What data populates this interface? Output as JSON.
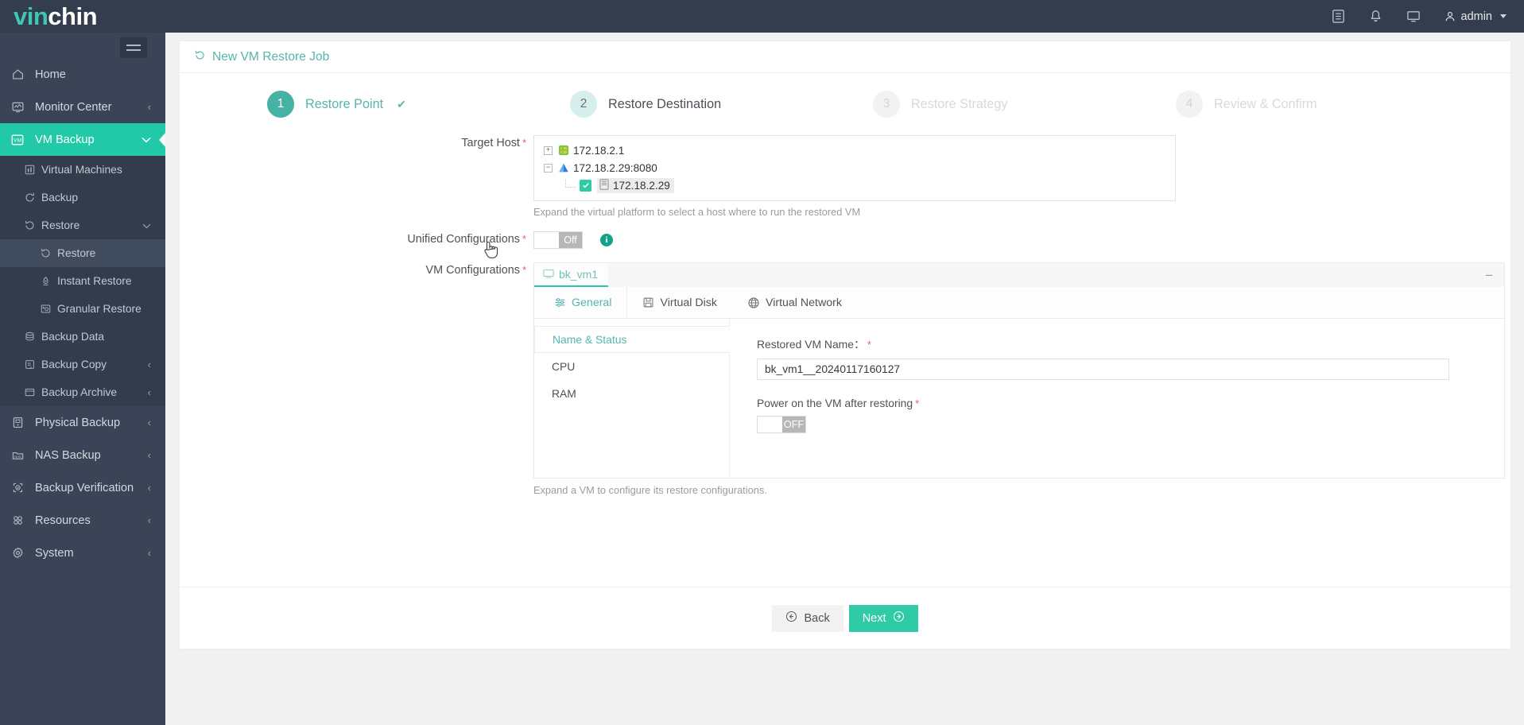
{
  "topbar": {
    "logo_part1": "vin",
    "logo_part2": "chin",
    "icons": [
      "list-icon",
      "bell-icon",
      "monitor-icon"
    ],
    "user": "admin"
  },
  "sidebar": {
    "hamburger": "hamburger-icon",
    "items": [
      {
        "label": "Home",
        "icon": "home-icon",
        "level": 1,
        "arrow": "",
        "state": ""
      },
      {
        "label": "Monitor Center",
        "icon": "monitor-center-icon",
        "level": 1,
        "arrow": "‹",
        "state": ""
      },
      {
        "label": "VM Backup",
        "icon": "vm-icon",
        "level": 1,
        "arrow": "⌄",
        "state": "active"
      },
      {
        "label": "Virtual Machines",
        "icon": "virtual-machines-icon",
        "level": 2,
        "arrow": "",
        "state": ""
      },
      {
        "label": "Backup",
        "icon": "backup-icon",
        "level": 2,
        "arrow": "",
        "state": ""
      },
      {
        "label": "Restore",
        "icon": "restore-icon",
        "level": 2,
        "arrow": "⌄",
        "state": ""
      },
      {
        "label": "Restore",
        "icon": "restore-icon",
        "level": 3,
        "arrow": "",
        "state": "sel"
      },
      {
        "label": "Instant Restore",
        "icon": "instant-restore-icon",
        "level": 3,
        "arrow": "",
        "state": ""
      },
      {
        "label": "Granular Restore",
        "icon": "granular-restore-icon",
        "level": 3,
        "arrow": "",
        "state": ""
      },
      {
        "label": "Backup Data",
        "icon": "database-icon",
        "level": 2,
        "arrow": "",
        "state": ""
      },
      {
        "label": "Backup Copy",
        "icon": "copy-icon",
        "level": 2,
        "arrow": "‹",
        "state": ""
      },
      {
        "label": "Backup Archive",
        "icon": "archive-icon",
        "level": 2,
        "arrow": "‹",
        "state": ""
      },
      {
        "label": "Physical Backup",
        "icon": "server-icon",
        "level": 1,
        "arrow": "‹",
        "state": ""
      },
      {
        "label": "NAS Backup",
        "icon": "nas-icon",
        "level": 1,
        "arrow": "‹",
        "state": ""
      },
      {
        "label": "Backup Verification",
        "icon": "verification-icon",
        "level": 1,
        "arrow": "‹",
        "state": ""
      },
      {
        "label": "Resources",
        "icon": "resources-icon",
        "level": 1,
        "arrow": "‹",
        "state": ""
      },
      {
        "label": "System",
        "icon": "gear-icon",
        "level": 1,
        "arrow": "‹",
        "state": ""
      }
    ]
  },
  "page": {
    "title": "New VM Restore Job",
    "title_icon": "restore-icon"
  },
  "stepper": [
    {
      "num": "1",
      "label": "Restore Point",
      "state": "done",
      "check": "✔"
    },
    {
      "num": "2",
      "label": "Restore Destination",
      "state": "cur",
      "check": ""
    },
    {
      "num": "3",
      "label": "Restore Strategy",
      "state": "off",
      "check": ""
    },
    {
      "num": "4",
      "label": "Review & Confirm",
      "state": "off",
      "check": ""
    }
  ],
  "form": {
    "target_host": {
      "label": "Target Host",
      "required": "*",
      "hint": "Expand the virtual platform to select a host where to run the restored VM",
      "nodes": [
        {
          "toggle": "+",
          "icon": "platform-icon",
          "label": "172.18.2.1"
        },
        {
          "toggle": "−",
          "icon": "cluster-icon",
          "label": "172.18.2.29:8080"
        },
        {
          "toggle": "",
          "icon": "host-icon",
          "label": "172.18.2.29",
          "checked": true
        }
      ]
    },
    "unified_configurations": {
      "label": "Unified Configurations",
      "required": "*",
      "toggle_state": "Off",
      "info_icon": "info-icon"
    },
    "vm_configurations": {
      "label": "VM Configurations",
      "required": "*",
      "vm_name": "bk_vm1",
      "vm_icon": "vm-screen-icon",
      "collapse": "−",
      "tabs": [
        {
          "label": "General",
          "icon": "sliders-icon",
          "active": true
        },
        {
          "label": "Virtual Disk",
          "icon": "floppy-disk-icon",
          "active": false
        },
        {
          "label": "Virtual Network",
          "icon": "globe-icon",
          "active": false
        }
      ],
      "subnav": [
        {
          "label": "Name & Status",
          "active": true
        },
        {
          "label": "CPU",
          "active": false
        },
        {
          "label": "RAM",
          "active": false
        }
      ],
      "fields": {
        "restored_vm_name_label": "Restored VM Name：",
        "restored_vm_name_required": "*",
        "restored_vm_name_value": "bk_vm1__20240117160127",
        "power_on_label": "Power on the VM after restoring",
        "power_on_required": "*",
        "power_on_state": "OFF"
      },
      "hint": "Expand a VM to configure its restore configurations."
    }
  },
  "footer": {
    "back_label": "Back",
    "next_label": "Next",
    "back_icon": "arrow-left-circle-icon",
    "next_icon": "arrow-right-circle-icon"
  },
  "colors": {
    "accent": "#2fcba7",
    "brand_dark": "#343d4d",
    "sidebar": "#3a4456",
    "link_teal": "#56b5ac"
  }
}
